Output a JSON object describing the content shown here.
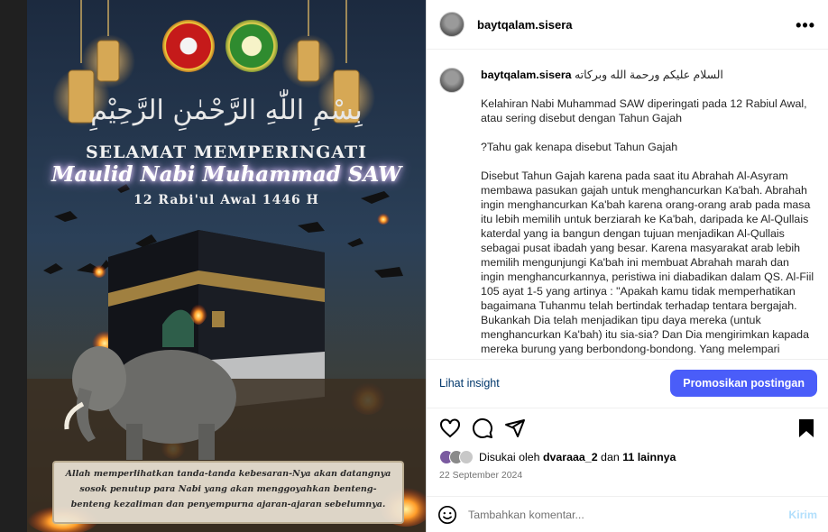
{
  "post": {
    "username": "baytqalam.sisera",
    "more_label": "•••"
  },
  "poster": {
    "basmala": "بِسْمِ اللّٰهِ الرَّحْمٰنِ الرَّحِيْمِ",
    "selamat": "SELAMAT MEMPERINGATI",
    "title": "Maulid Nabi Muhammad SAW",
    "date": "12 Rabi'ul Awal 1446 H",
    "caption": "Allah memperlihatkan tanda-tanda kebesaran-Nya akan datangnya sosok penutup para Nabi yang akan menggoyahkan benteng-benteng kezaliman dan penyempurna ajaran-ajaran sebelumnya."
  },
  "comment": {
    "username": "baytqalam.sisera",
    "greeting": "السلام عليكم ورحمة الله وبركاته",
    "paragraphs": [
      "Kelahiran Nabi Muhammad SAW diperingati pada 12 Rabiul Awal, atau sering disebut dengan Tahun Gajah",
      "?Tahu gak kenapa disebut Tahun Gajah",
      "Disebut Tahun Gajah karena pada saat itu Abrahah Al-Asyram membawa pasukan gajah untuk menghancurkan Ka'bah. Abrahah ingin menghancurkan Ka'bah karena orang-orang arab pada masa itu lebih memilih untuk berziarah ke Ka'bah, daripada ke Al-Qullais katerdal yang ia bangun dengan tujuan menjadikan Al-Qullais sebagai pusat ibadah yang besar. Karena masyarakat arab lebih memilih mengunjungi Ka'bah ini membuat Abrahah marah dan ingin menghancurkannya, peristiwa ini diabadikan dalam QS. Al-Fiil 105 ayat 1-5 yang artinya : \"Apakah kamu tidak memperhatikan bagaimana Tuhanmu telah bertindak terhadap tentara bergajah. Bukankah Dia telah menjadikan tipu daya mereka (untuk menghancurkan Ka'bah) itu sia-sia? Dan Dia mengirimkan kapada mereka burung yang berbondong-bondong. Yang melempari"
    ]
  },
  "actions": {
    "insight_label": "Lihat insight",
    "promote_label": "Promosikan postingan"
  },
  "likes": {
    "prefix": "Disukai oleh",
    "user": "dvaraaa_2",
    "conj": "dan",
    "others": "11 lainnya"
  },
  "date": "22 September 2024",
  "add_comment": {
    "placeholder": "Tambahkan komentar...",
    "send_label": "Kirim"
  },
  "colors": {
    "accent": "#4a5df9",
    "link": "#00376b"
  }
}
